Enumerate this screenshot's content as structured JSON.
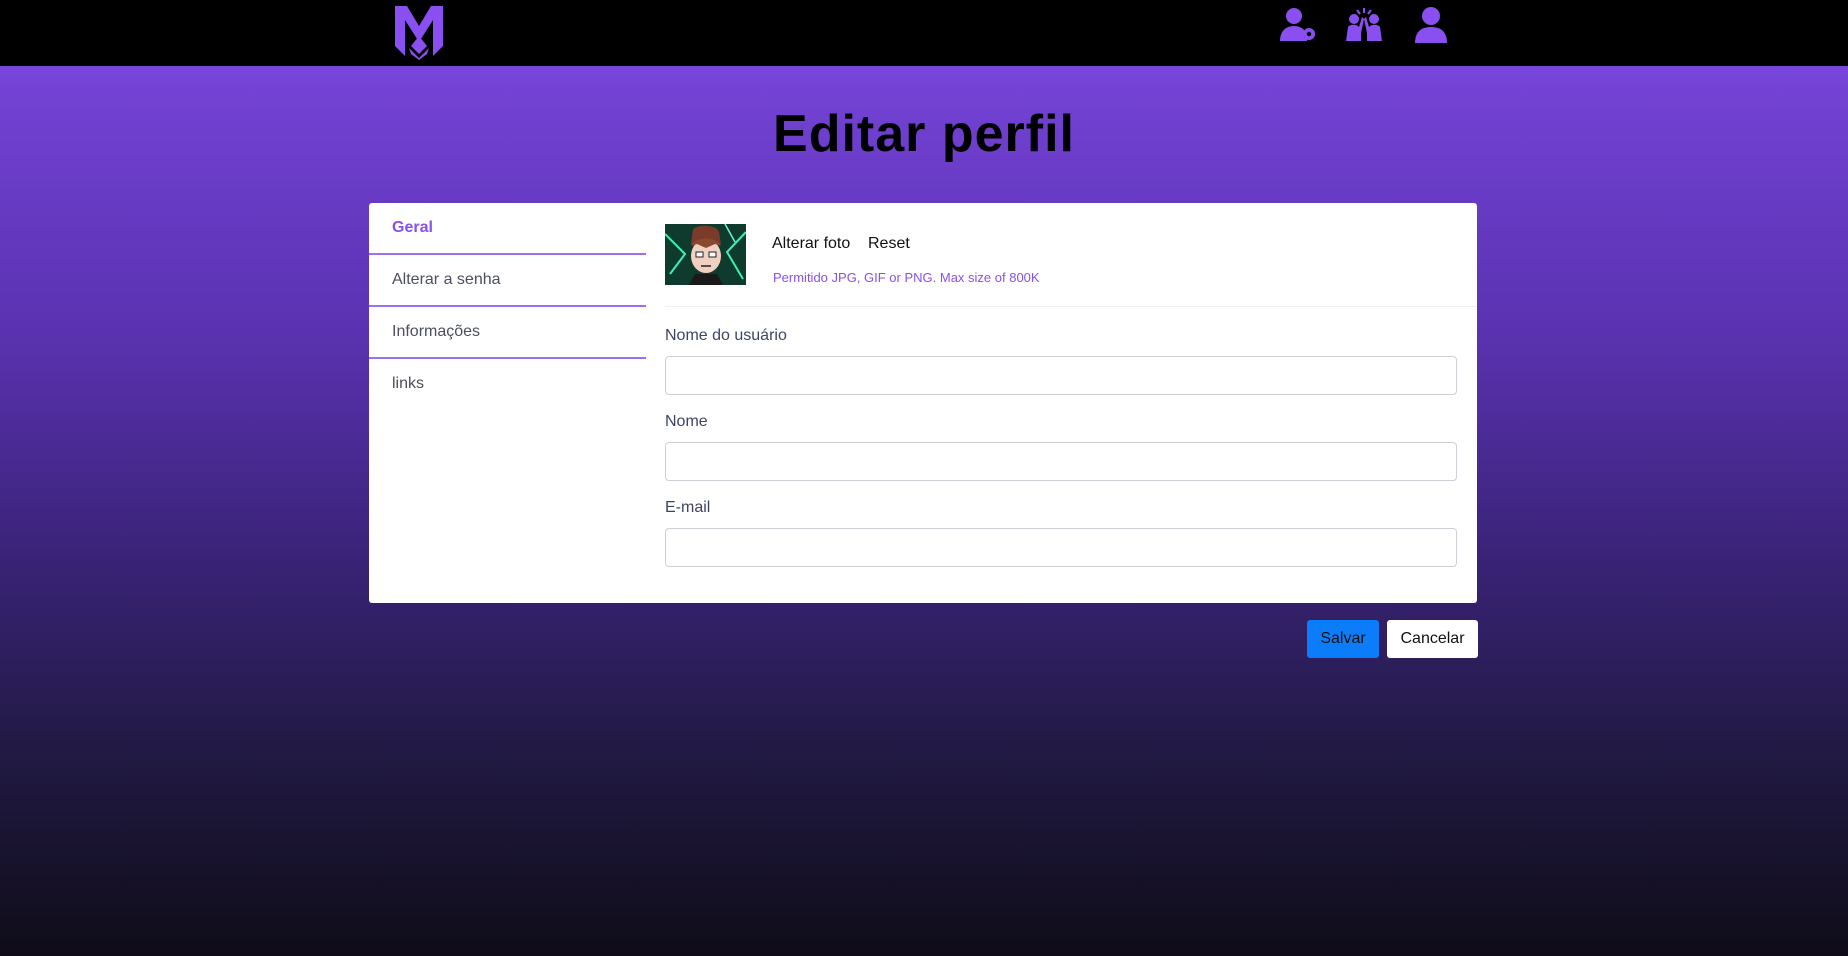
{
  "header": {
    "logo_icon": "mx-logo-icon",
    "icons": [
      "user-key-icon",
      "group-celebrate-icon",
      "user-profile-icon"
    ],
    "accent_color": "#8a4ff0"
  },
  "page": {
    "title": "Editar perfil"
  },
  "sidebar": {
    "items": [
      {
        "label": "Geral",
        "active": true
      },
      {
        "label": "Alterar a senha",
        "active": false
      },
      {
        "label": "Informações",
        "active": false
      },
      {
        "label": "links",
        "active": false
      }
    ]
  },
  "photo": {
    "change_label": "Alterar foto",
    "reset_label": "Reset",
    "hint": "Permitido JPG, GIF or PNG. Max size of 800K"
  },
  "form": {
    "username_label": "Nome do usuário",
    "username_value": "",
    "name_label": "Nome",
    "name_value": "",
    "email_label": "E-mail",
    "email_value": ""
  },
  "actions": {
    "save_label": "Salvar",
    "cancel_label": "Cancelar",
    "save_color": "#0b7dfa"
  }
}
